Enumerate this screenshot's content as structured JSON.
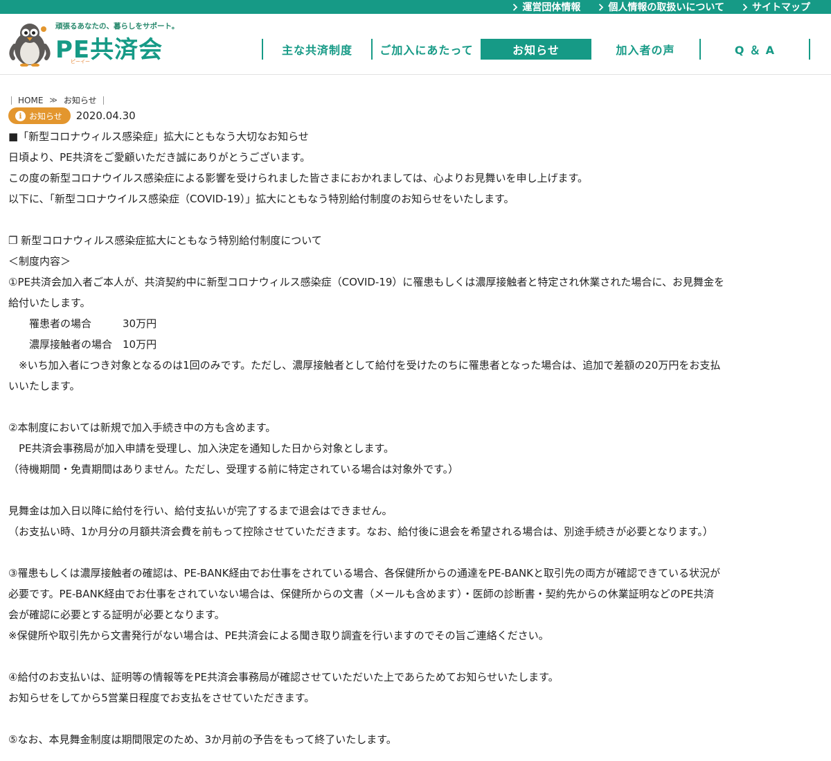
{
  "topbar": {
    "links": [
      "運営団体情報",
      "個人情報の取扱いについて",
      "サイトマップ"
    ]
  },
  "logo": {
    "tagline": "頑張るあなたの、暮らしをサポート。",
    "name": "PE共済会",
    "reading": "ピーイー"
  },
  "nav": {
    "items": [
      "主な共済制度",
      "ご加入にあたって",
      "お知らせ",
      "加入者の声",
      "Q ＆ A"
    ]
  },
  "breadcrumb": {
    "home": "HOME",
    "current": "お知らせ"
  },
  "post": {
    "category": "お知らせ",
    "date": "2020.04.30"
  },
  "article": {
    "lines": [
      "■「新型コロナウィルス感染症」拡大にともなう大切なお知らせ",
      "日頃より、PE共済をご愛顧いただき誠にありがとうございます。",
      "この度の新型コロナウイルス感染症による影響を受けられました皆さまにおかれましては、心よりお見舞いを申し上げます。",
      "以下に、「新型コロナウイルス感染症（COVID-19）」拡大にともなう特別給付制度のお知らせをいたします。",
      "",
      "❐ 新型コロナウィルス感染症拡大にともなう特別給付制度について",
      "＜制度内容＞",
      "①PE共済会加入者ご本人が、共済契約中に新型コロナウィルス感染症（COVID-19）に罹患もしくは濃厚接触者と特定され休業された場合に、お見舞金を",
      "給付いたします。",
      "　　罹患者の場合　　　30万円",
      "　　濃厚接触者の場合　10万円",
      "　※いち加入者につき対象となるのは1回のみです。ただし、濃厚接触者として給付を受けたのちに罹患者となった場合は、追加で差額の20万円をお支払",
      "いいたします。",
      "",
      "②本制度においては新規で加入手続き中の方も含めます。",
      "　PE共済会事務局が加入申請を受理し、加入決定を通知した日から対象とします。",
      "（待機期間・免責期間はありません。ただし、受理する前に特定されている場合は対象外です。）",
      "",
      "見舞金は加入日以降に給付を行い、給付支払いが完了するまで退会はできません。",
      "（お支払い時、1か月分の月額共済会費を前もって控除させていただきます。なお、給付後に退会を希望される場合は、別途手続きが必要となります。）",
      "",
      "③罹患もしくは濃厚接触者の確認は、PE-BANK経由でお仕事をされている場合、各保健所からの通達をPE-BANKと取引先の両方が確認できている状況が",
      "必要です。PE-BANK経由でお仕事をされていない場合は、保健所からの文書（メールも含めます）・医師の診断書・契約先からの休業証明などのPE共済",
      "会が確認に必要とする証明が必要となります。",
      "※保健所や取引先から文書発行がない場合は、PE共済会による聞き取り調査を行いますのでその旨ご連絡ください。",
      "",
      "④給付のお支払いは、証明等の情報等をPE共済会事務局が確認させていただいた上であらためてお知らせいたします。",
      "お知らせをしてから5営業日程度でお支払をさせていただきます。",
      "",
      "⑤なお、本見舞金制度は期間限定のため、3か月前の予告をもって終了いたします。"
    ]
  },
  "colors": {
    "brand": "#169a86",
    "badge": "#e3962e"
  }
}
